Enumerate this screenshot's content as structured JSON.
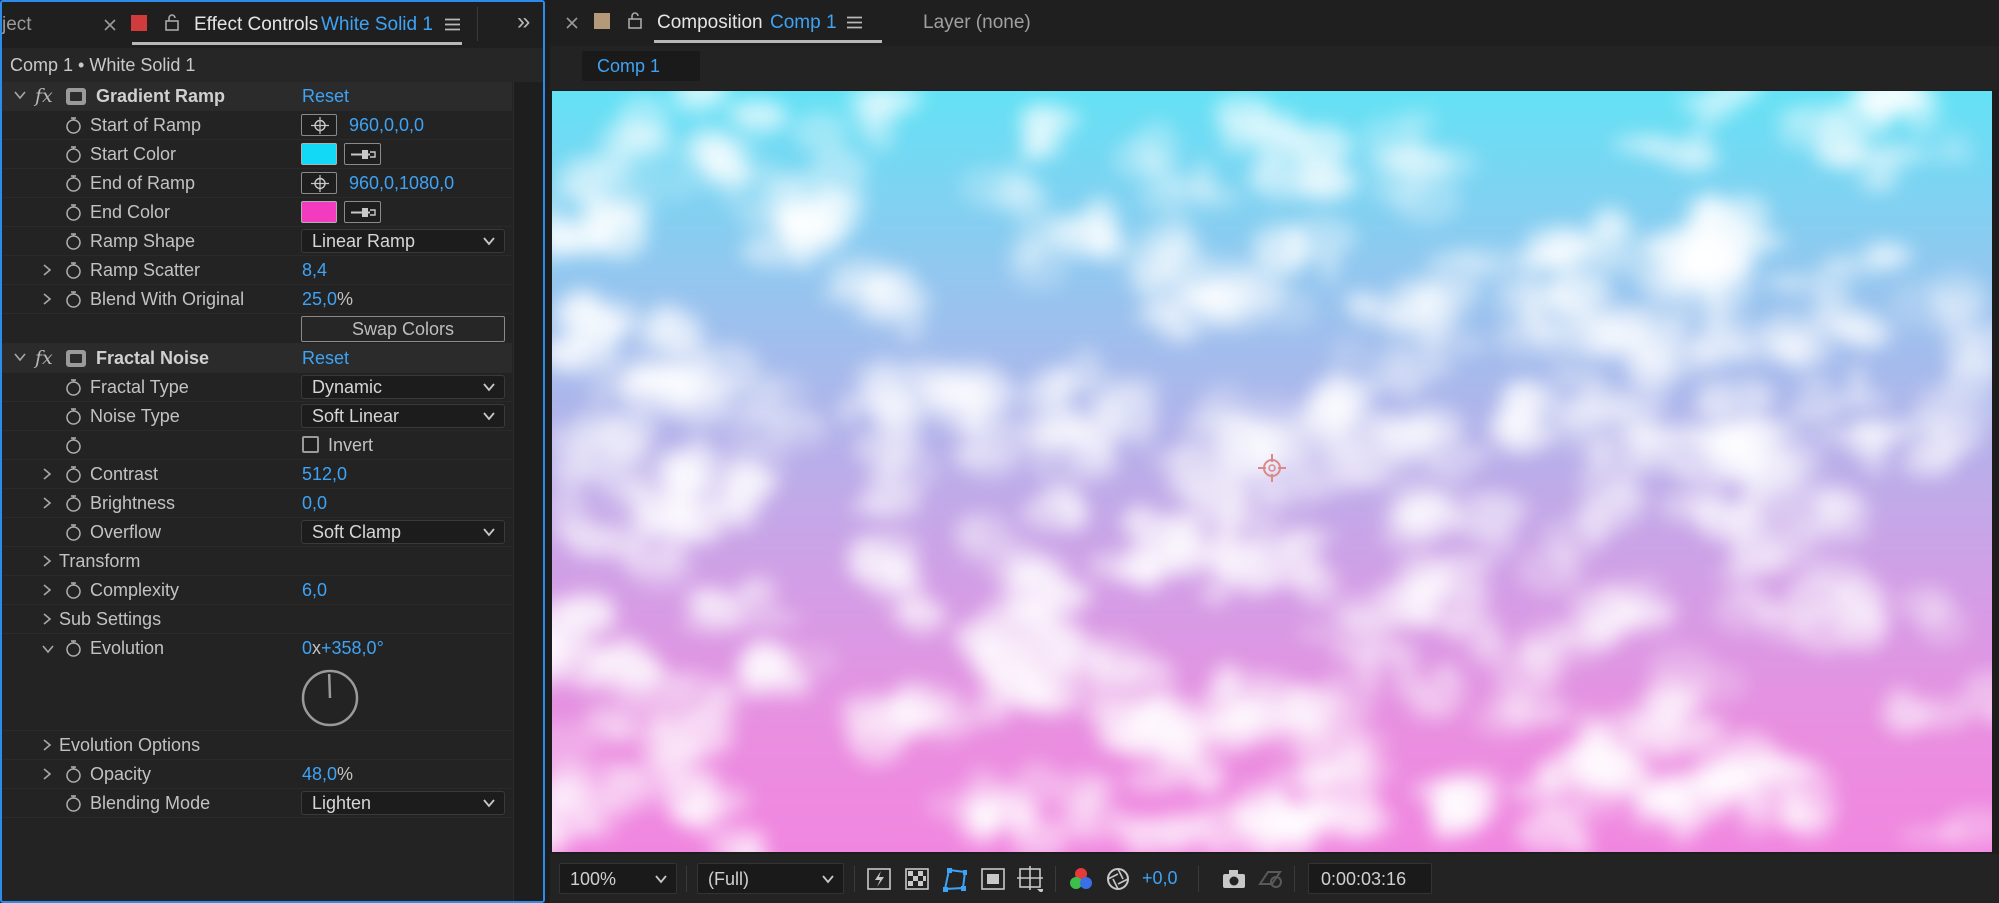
{
  "left_tabs": {
    "project_tab_label": "ject",
    "effect_controls_label": "Effect Controls",
    "effect_controls_layer": "White Solid 1",
    "overflow_glyph": "»"
  },
  "left_header": {
    "breadcrumb": "Comp 1 • White Solid 1"
  },
  "gradient_ramp": {
    "name": "Gradient Ramp",
    "reset": "Reset",
    "start_of_ramp": {
      "label": "Start of Ramp",
      "value": "960,0,0,0"
    },
    "start_color": {
      "label": "Start Color",
      "color": "#12d9f5"
    },
    "end_of_ramp": {
      "label": "End of Ramp",
      "value": "960,0,1080,0"
    },
    "end_color": {
      "label": "End Color",
      "color": "#f23bbf"
    },
    "ramp_shape": {
      "label": "Ramp Shape",
      "value": "Linear Ramp"
    },
    "ramp_scatter": {
      "label": "Ramp Scatter",
      "value": "8,4"
    },
    "blend_with_original": {
      "label": "Blend With Original",
      "value": "25,0",
      "unit": "%"
    },
    "swap_colors": "Swap Colors"
  },
  "fractal_noise": {
    "name": "Fractal Noise",
    "reset": "Reset",
    "fractal_type": {
      "label": "Fractal Type",
      "value": "Dynamic"
    },
    "noise_type": {
      "label": "Noise Type",
      "value": "Soft Linear"
    },
    "invert": {
      "label": "Invert",
      "checked": false
    },
    "contrast": {
      "label": "Contrast",
      "value": "512,0"
    },
    "brightness": {
      "label": "Brightness",
      "value": "0,0"
    },
    "overflow": {
      "label": "Overflow",
      "value": "Soft Clamp"
    },
    "transform": {
      "label": "Transform"
    },
    "complexity": {
      "label": "Complexity",
      "value": "6,0"
    },
    "sub_settings": {
      "label": "Sub Settings"
    },
    "evolution": {
      "label": "Evolution",
      "revolutions": "0",
      "x_sep": "x",
      "degrees": "+358,0°"
    },
    "evolution_options": {
      "label": "Evolution Options"
    },
    "opacity": {
      "label": "Opacity",
      "value": "48,0",
      "unit": "%"
    },
    "blending_mode": {
      "label": "Blending Mode",
      "value": "Lighten"
    }
  },
  "right_tabs": {
    "composition_label": "Composition",
    "composition_name": "Comp 1",
    "layer_label": "Layer (none)",
    "comp_chip": "Comp 1"
  },
  "viewer_toolbar": {
    "zoom": "100%",
    "resolution": "(Full)",
    "exposure": "+0,0",
    "timecode": "0:00:03:16"
  },
  "colors": {
    "accent_blue": "#3ea3f5",
    "panel_border": "#2d8ceb",
    "project_tab_swatch": "#d13b3b",
    "composition_tab_swatch": "#b59a7a"
  }
}
